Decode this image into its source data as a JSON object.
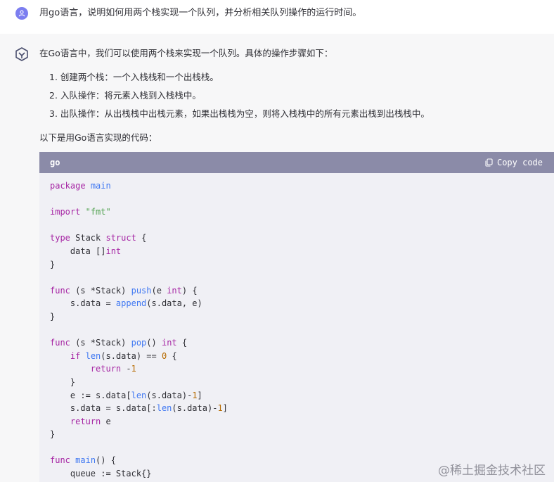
{
  "user": {
    "message": "用go语言，说明如何用两个栈实现一个队列，并分析相关队列操作的运行时间。"
  },
  "assistant": {
    "intro": "在Go语言中，我们可以使用两个栈来实现一个队列。具体的操作步骤如下：",
    "steps": [
      "1. 创建两个栈：一个入栈栈和一个出栈栈。",
      "2. 入队操作：将元素入栈到入栈栈中。",
      "3. 出队操作：从出栈栈中出栈元素，如果出栈栈为空，则将入栈栈中的所有元素出栈到出栈栈中。"
    ],
    "code_intro": "以下是用Go语言实现的代码："
  },
  "code_block": {
    "language": "go",
    "copy_label": "Copy code",
    "lines": [
      "package main",
      "",
      "import \"fmt\"",
      "",
      "type Stack struct {",
      "    data []int",
      "}",
      "",
      "func (s *Stack) push(e int) {",
      "    s.data = append(s.data, e)",
      "}",
      "",
      "func (s *Stack) pop() int {",
      "    if len(s.data) == 0 {",
      "        return -1",
      "    }",
      "    e := s.data[len(s.data)-1]",
      "    s.data = s.data[:len(s.data)-1]",
      "    return e",
      "}",
      "",
      "func main() {",
      "    queue := Stack{}"
    ]
  },
  "watermark": "@稀土掘金技术社区",
  "colors": {
    "user_avatar": "#7c7ef0",
    "code_header": "#8b8ba8",
    "code_bg": "#f0f0f5",
    "assistant_bg": "#f7f7f8"
  }
}
